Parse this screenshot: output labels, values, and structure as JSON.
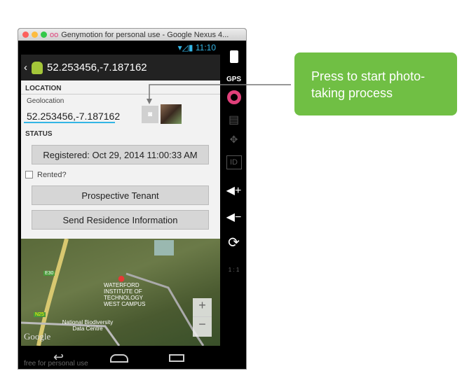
{
  "window": {
    "title": "Genymotion for personal use - Google Nexus 4...",
    "watermark": "free for personal use"
  },
  "statusbar": {
    "time": "11:10"
  },
  "actionbar": {
    "title": "52.253456,-7.187162"
  },
  "location": {
    "header": "LOCATION",
    "geolocation_label": "Geolocation",
    "geolocation_value": "52.253456,-7.187162"
  },
  "status": {
    "header": "STATUS",
    "registered_button": "Registered: Oct 29, 2014 11:00:33 AM",
    "rented_label": "Rented?",
    "rented_checked": false,
    "tenant_button": "Prospective Tenant",
    "send_button": "Send Residence Information"
  },
  "map": {
    "road1": "E30",
    "road2": "N25",
    "place1": "WATERFORD INSTITUTE OF TECHNOLOGY WEST CAMPUS",
    "place2": "National Biodiversity Data Centre",
    "logo": "Google",
    "zoom_in": "+",
    "zoom_out": "−"
  },
  "sidebar": {
    "gps": "GPS",
    "id": "ID",
    "scale": "1 : 1"
  },
  "callout": {
    "text": "Press to start photo-taking process",
    "color": "#70bf44"
  }
}
